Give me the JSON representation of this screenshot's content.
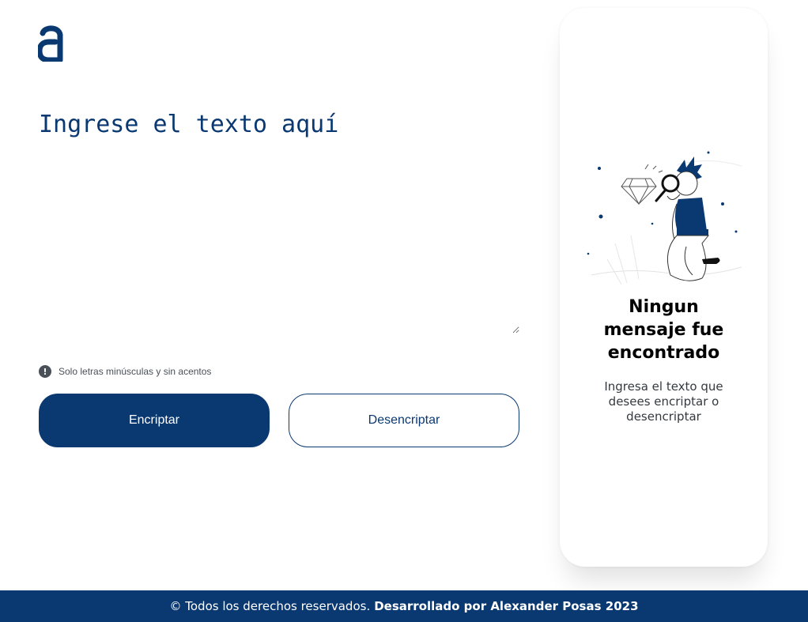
{
  "logo": {
    "icon": "alura-a-logo-icon"
  },
  "input": {
    "placeholder": "Ingrese el texto aquí"
  },
  "hint": {
    "icon": "exclamation-circle-icon",
    "text": "Solo letras minúsculas y sin acentos"
  },
  "buttons": {
    "encrypt_label": "Encriptar",
    "decrypt_label": "Desencriptar"
  },
  "panel": {
    "illustration": "person-with-magnifying-glass-and-diamond-illustration",
    "title": "Ningun mensaje fue encontrado",
    "text": "Ingresa el texto que desees encriptar o desencriptar"
  },
  "footer": {
    "text": "© Todos los derechos reservados.",
    "author": "Desarrollado por Alexander Posas 2023"
  },
  "colors": {
    "brand": "#0a3871",
    "hint": "#495057",
    "background": "#ffffff"
  }
}
